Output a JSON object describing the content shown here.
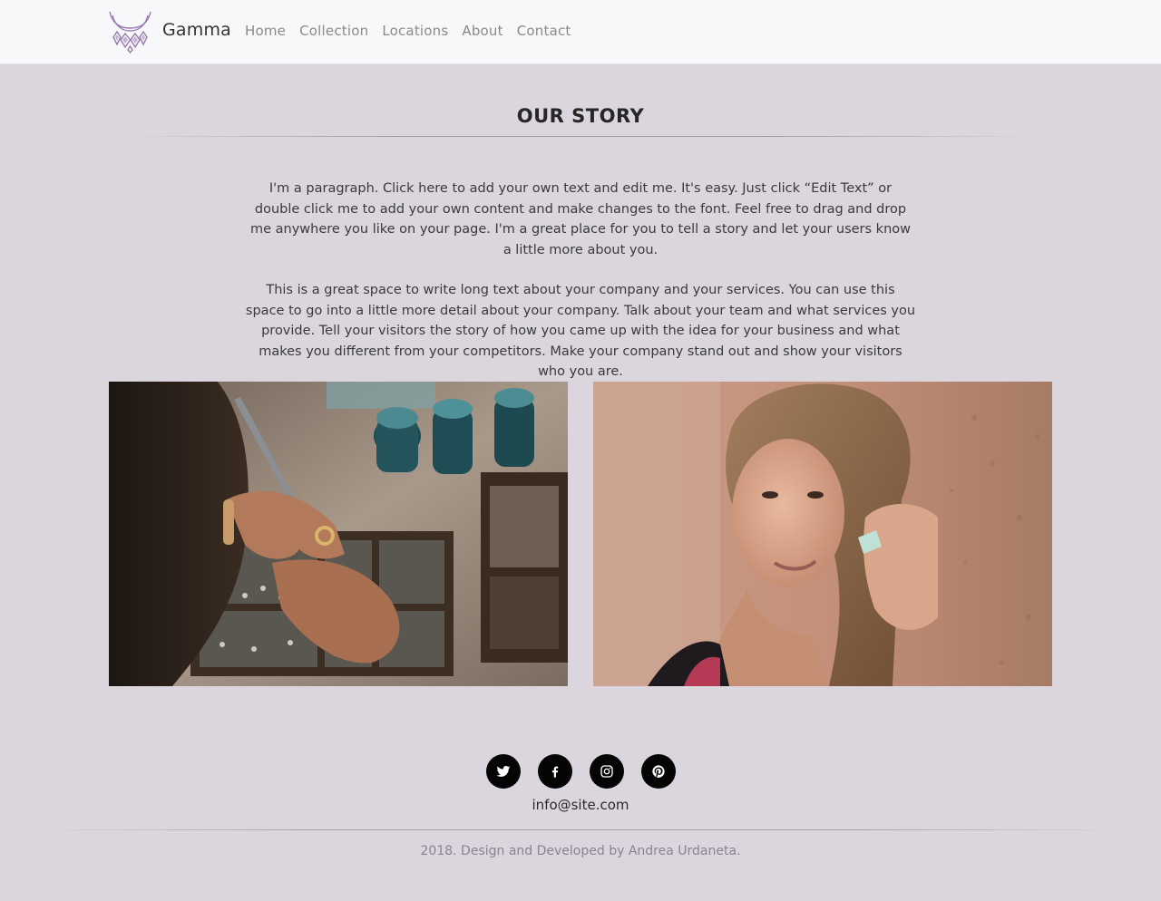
{
  "nav": {
    "brand": "Gamma",
    "logo_icon": "necklace-logo-icon",
    "links": [
      "Home",
      "Collection",
      "Locations",
      "About",
      "Contact"
    ]
  },
  "story": {
    "title": "OUR STORY",
    "paragraphs": [
      "I'm a paragraph. Click here to add your own text and edit me. It's easy. Just click “Edit Text” or double click me to add your own content and make changes to the font. Feel free to drag and drop me anywhere you like on your page. I'm a great place for you to tell a story and let your users know a little more about you.",
      "This is a great space to write long text about your company and your services. You can use this space to go into a little more detail about your company. Talk about your team and what services you provide. Tell your visitors the story of how you came up with the idea for your business and what makes you different from your competitors. Make your company stand out and show your visitors who you are."
    ]
  },
  "images": [
    {
      "subject": "hands-sorting-rings-jewelry-box-photo"
    },
    {
      "subject": "woman-wearing-ring-portrait-photo"
    }
  ],
  "footer": {
    "socials": [
      "twitter-icon",
      "facebook-icon",
      "instagram-icon",
      "pinterest-icon"
    ],
    "email": "info@site.com",
    "credits": "2018. Design and Developed by Andrea Urdaneta."
  },
  "colors": {
    "page_background": "#dbd5de",
    "navbar_background": "#f7f8fa",
    "logo_accent": "#9b7bb0",
    "social_button": "#050505",
    "credits_text": "#8a8391"
  }
}
